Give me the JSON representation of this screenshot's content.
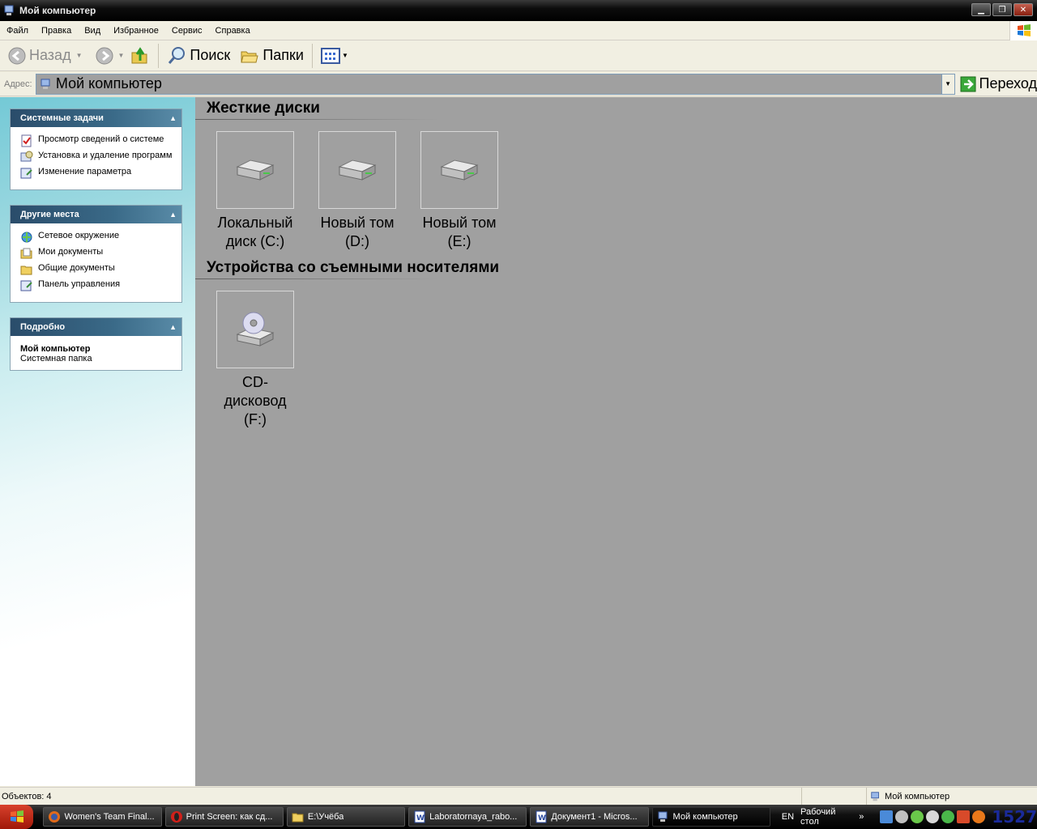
{
  "window": {
    "title": "Мой компьютер"
  },
  "menu": [
    "Файл",
    "Правка",
    "Вид",
    "Избранное",
    "Сервис",
    "Справка"
  ],
  "toolbar": {
    "back": "Назад",
    "search": "Поиск",
    "folders": "Папки"
  },
  "address": {
    "label": "Адрес:",
    "value": "Мой компьютер",
    "go": "Переход"
  },
  "left": {
    "system_tasks": {
      "title": "Системные задачи",
      "items": [
        "Просмотр сведений о системе",
        "Установка и удаление программ",
        "Изменение параметра"
      ]
    },
    "other_places": {
      "title": "Другие места",
      "items": [
        "Сетевое окружение",
        "Мои документы",
        "Общие документы",
        "Панель управления"
      ]
    },
    "details": {
      "title": "Подробно",
      "name": "Мой компьютер",
      "type": "Системная папка"
    }
  },
  "groups": {
    "hard_disks": {
      "title": "Жесткие диски",
      "drives": [
        "Локальный\nдиск (C:)",
        "Новый том\n(D:)",
        "Новый том\n(E:)"
      ]
    },
    "removable": {
      "title": "Устройства со съемными носителями",
      "drives": [
        "CD-дисковод\n(F:)"
      ]
    }
  },
  "status": {
    "objects": "Объектов: 4",
    "location": "Мой компьютер"
  },
  "taskbar": {
    "items": [
      "Women's Team Final...",
      "Print Screen: как сд...",
      "E:\\Учёба",
      "Laboratornaya_rabo...",
      "Документ1 - Micros...",
      "Мой компьютер"
    ],
    "lang": "EN",
    "desktop": "Рабочий стол",
    "chevron": "»",
    "clock": "1527"
  }
}
